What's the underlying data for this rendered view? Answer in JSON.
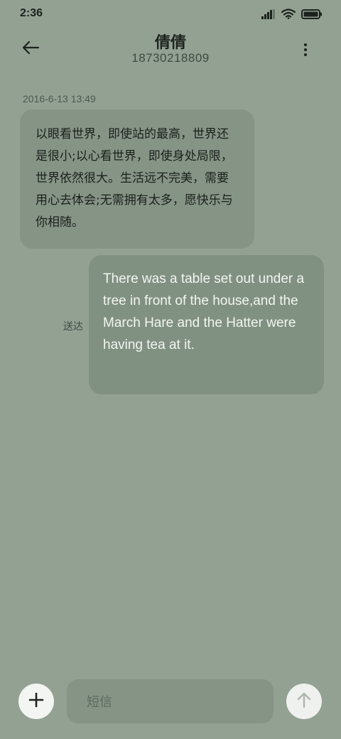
{
  "status_bar": {
    "time": "2:36",
    "icons": [
      "signal-icon",
      "wifi-icon",
      "battery-icon"
    ]
  },
  "header": {
    "contact_name": "倩倩",
    "contact_number": "18730218809",
    "icons": [
      "back-arrow-icon",
      "more-vertical-icon"
    ]
  },
  "conversation": {
    "timestamp": "2016-6-13 13:49",
    "messages": [
      {
        "direction": "incoming",
        "text": "以眼看世界，即使站的最高，世界还是很小;以心看世界，即使身处局限，世界依然很大。生活远不完美，需要用心去体会;无需拥有太多，愿快乐与你相随。"
      },
      {
        "direction": "outgoing",
        "text": "There was a table set out under a tree in front of the house,and the March Hare and the Hatter were having tea at it.",
        "status": "送达"
      }
    ]
  },
  "composer": {
    "placeholder": "短信",
    "icons": [
      "plus-icon",
      "send-arrow-icon"
    ]
  },
  "colors": {
    "background": "#93a193",
    "incoming_bubble": "#869486",
    "outgoing_bubble": "#819181",
    "button_bg": "#f3f5f2"
  }
}
